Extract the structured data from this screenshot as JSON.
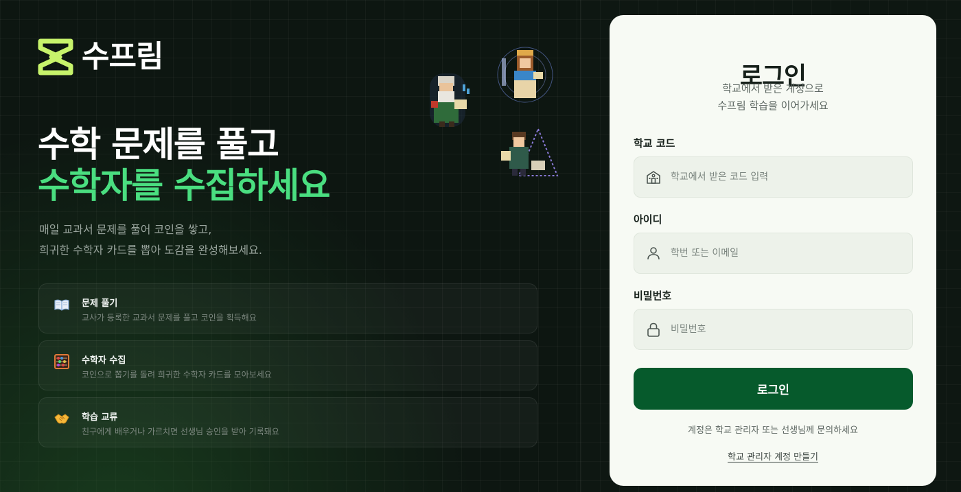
{
  "brand": {
    "name": "수프림",
    "accent_color": "#c7f36b",
    "logo_icon": "hourglass-x-logo"
  },
  "hero": {
    "line1": "수학 문제를 풀고",
    "line2": "수학자를 수집하세요",
    "line2_color": "#4ade80",
    "desc_line1": "매일 교과서 문제를 풀어 코인을 쌓고,",
    "desc_line2": "희귀한 수학자 카드를 뽑아 도감을 완성해보세요."
  },
  "characters": [
    {
      "icon": "mathematician-old-sage-pixel"
    },
    {
      "icon": "mathematician-greek-lady-pixel"
    },
    {
      "icon": "mathematician-pascal-triangle-pixel"
    }
  ],
  "features": [
    {
      "icon": "open-book-icon",
      "title": "문제 풀기",
      "desc": "교사가 등록한 교과서 문제를 풀고 코인을 획득해요"
    },
    {
      "icon": "abacus-icon",
      "title": "수학자 수집",
      "desc": "코인으로 뽑기를 돌려 희귀한 수학자 카드를 모아보세요"
    },
    {
      "icon": "handshake-icon",
      "title": "학습 교류",
      "desc": "친구에게 배우거나 가르치면 선생님 승인을 받아 기록돼요"
    }
  ],
  "login": {
    "title": "로그인",
    "subtitle_line1": "학교에서 받은 계정으로",
    "subtitle_line2": "수프림 학습을 이어가세요",
    "school_code": {
      "label": "학교 코드",
      "placeholder": "학교에서 받은 코드 입력",
      "value": "",
      "icon": "school-building-icon"
    },
    "user_id": {
      "label": "아이디",
      "placeholder": "학번 또는 이메일",
      "value": "",
      "icon": "user-icon"
    },
    "password": {
      "label": "비밀번호",
      "placeholder": "비밀번호",
      "value": "",
      "icon": "lock-icon"
    },
    "submit_label": "로그인",
    "submit_color": "#065a2c",
    "notice": "계정은 학교 관리자 또는 선생님께 문의하세요",
    "admin_link": "학교 관리자 계정 만들기"
  }
}
